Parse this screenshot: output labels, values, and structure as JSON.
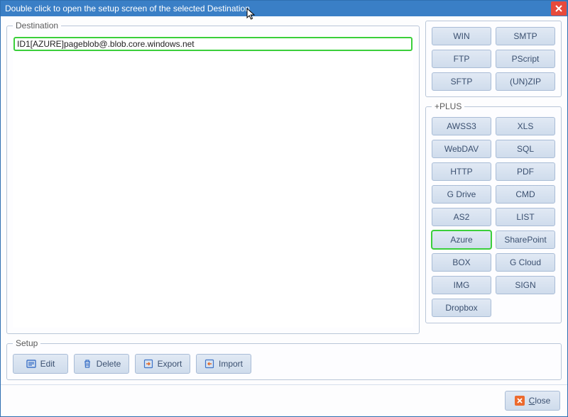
{
  "window": {
    "title": "Double click to open the setup screen of the selected Destination"
  },
  "destination": {
    "legend": "Destination",
    "items": [
      "ID1[AZURE]pageblob@.blob.core.windows.net"
    ]
  },
  "basic_buttons": {
    "items": [
      "WIN",
      "SMTP",
      "FTP",
      "PScript",
      "SFTP",
      "(UN)ZIP"
    ]
  },
  "plus": {
    "legend": "+PLUS",
    "items": [
      "AWSS3",
      "XLS",
      "WebDAV",
      "SQL",
      "HTTP",
      "PDF",
      "G Drive",
      "CMD",
      "AS2",
      "LIST",
      "Azure",
      "SharePoint",
      "BOX",
      "G Cloud",
      "IMG",
      "SIGN",
      "Dropbox"
    ],
    "highlighted": "Azure"
  },
  "setup": {
    "legend": "Setup",
    "edit": "Edit",
    "delete": "Delete",
    "export": "Export",
    "import": "Import"
  },
  "footer": {
    "close": "Close"
  }
}
